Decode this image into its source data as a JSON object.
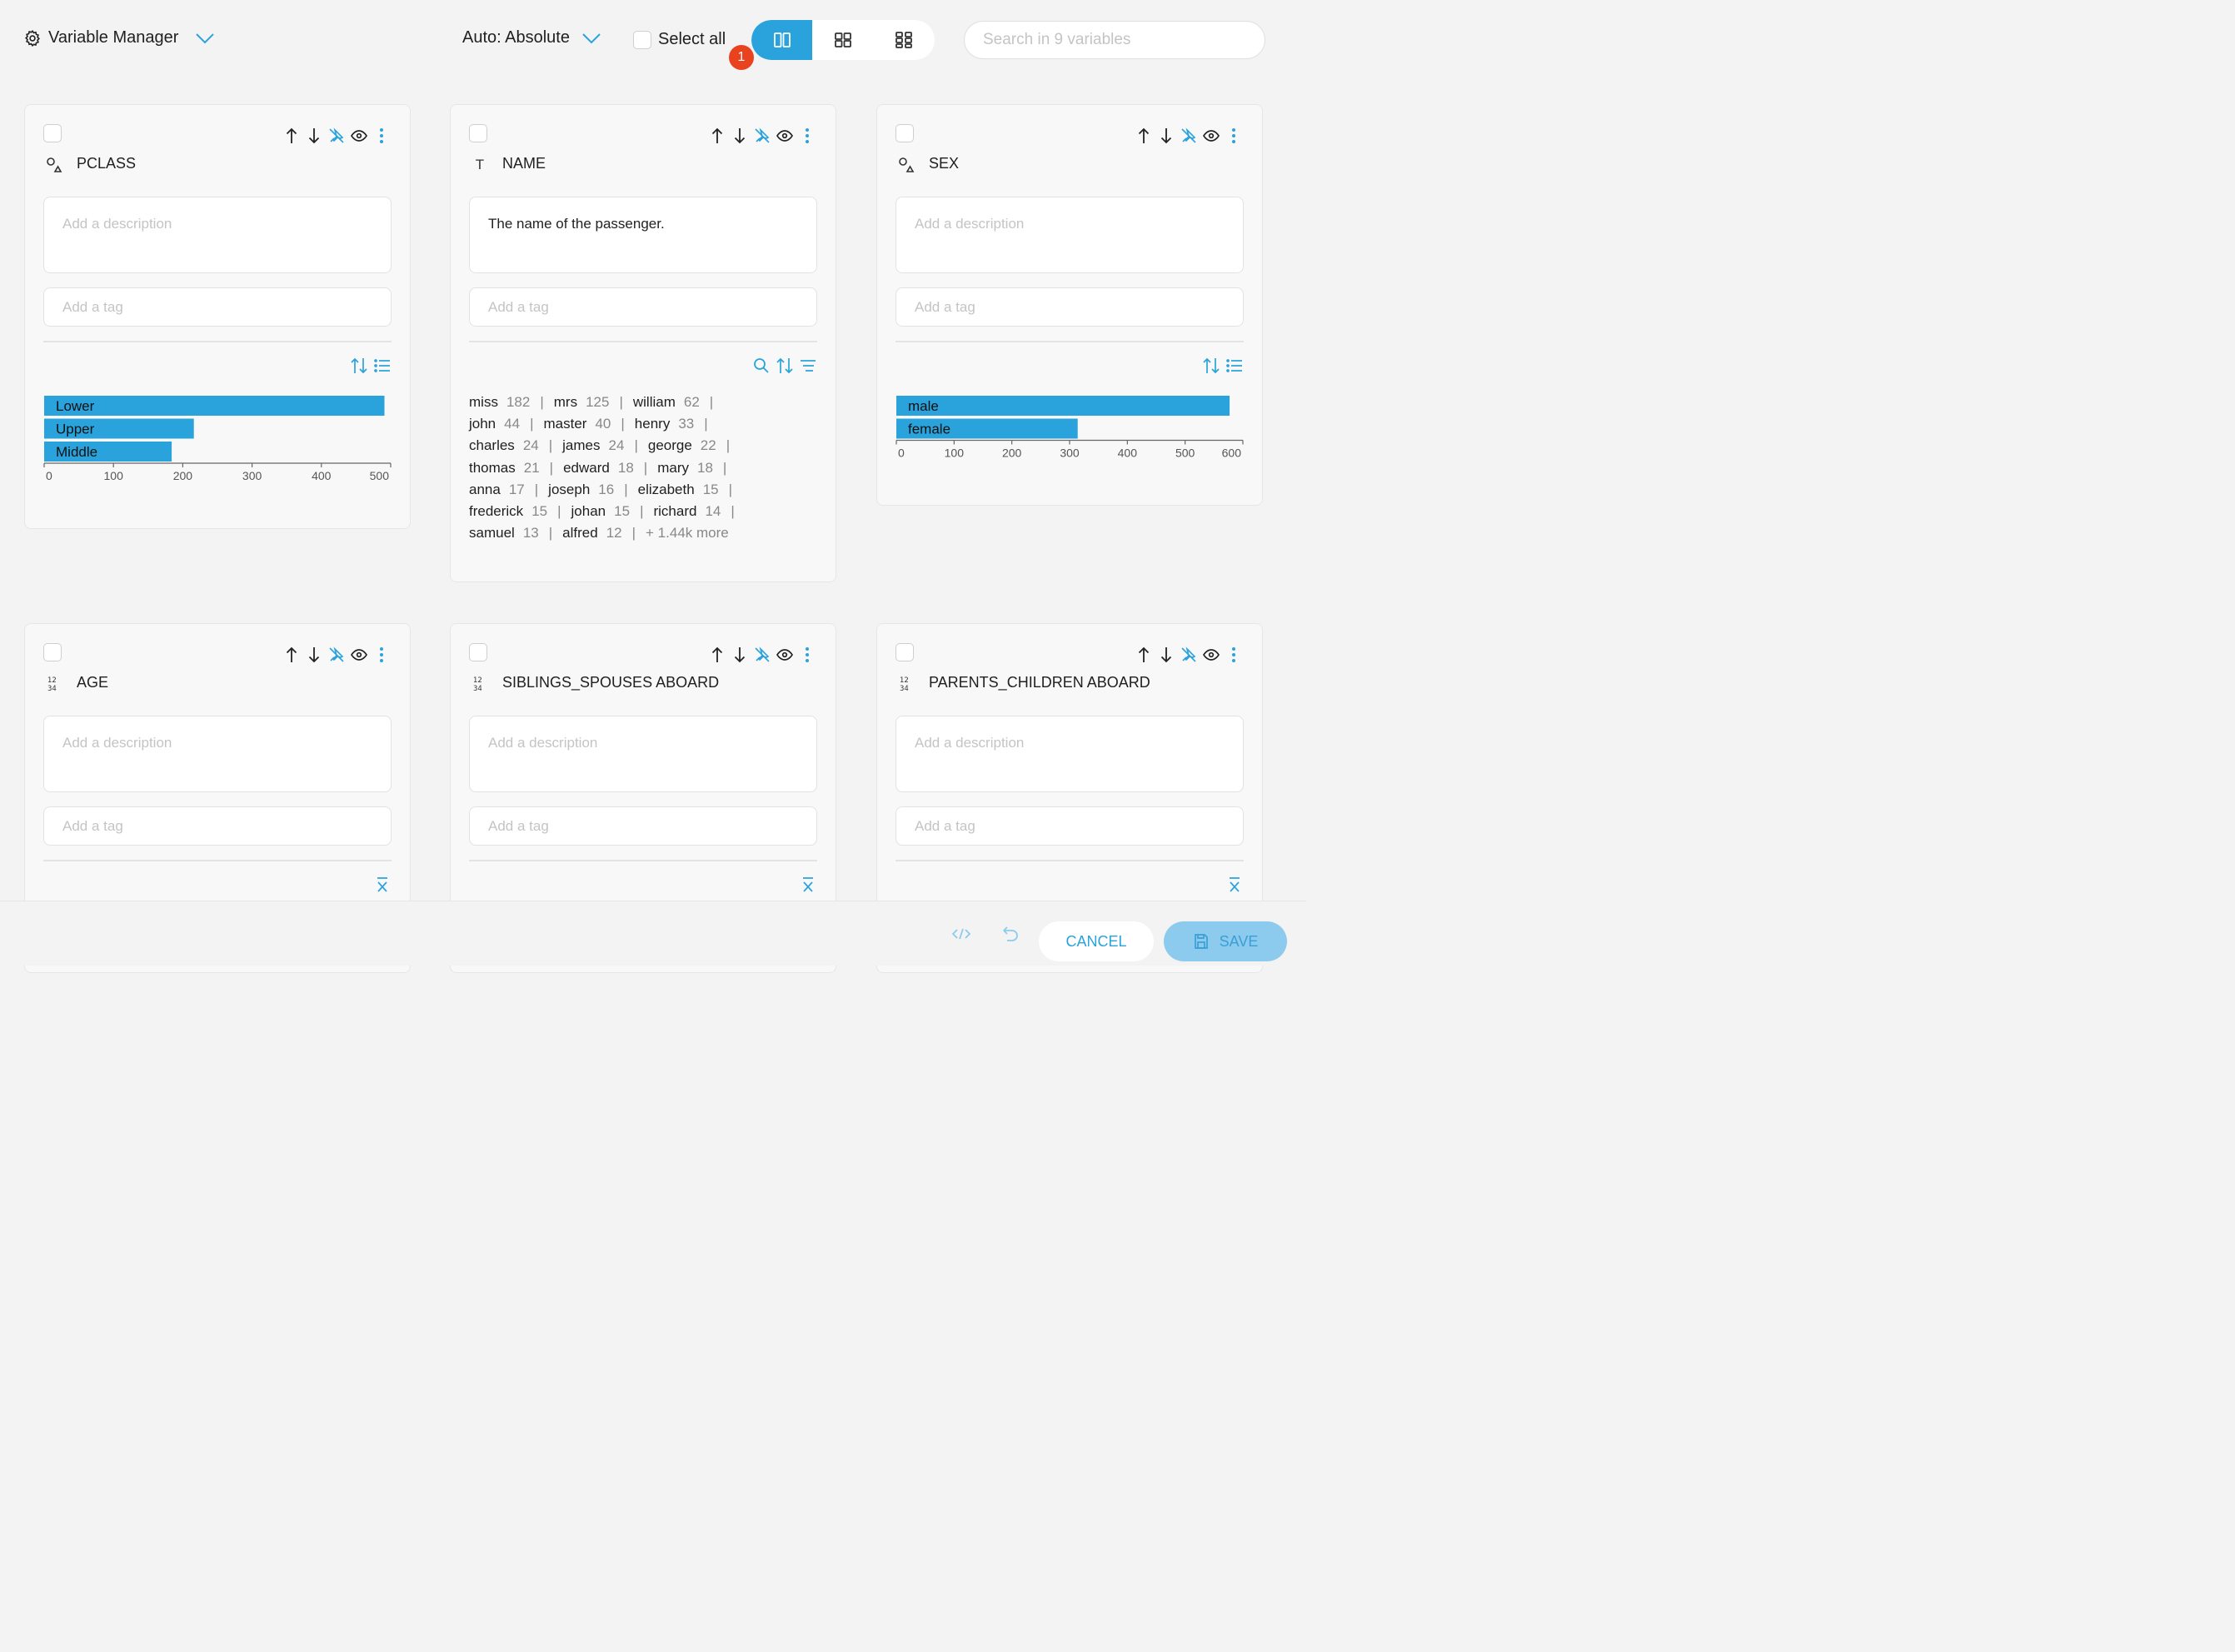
{
  "header": {
    "title": "Variable Manager",
    "mode_label": "Auto: Absolute",
    "select_all_label": "Select all",
    "badge_count": "1",
    "search_placeholder": "Search in 9 variables"
  },
  "colors": {
    "accent": "#2aa3dd",
    "badge": "#e8421f",
    "bar": "#2aa3dd"
  },
  "cards": [
    {
      "name": "PCLASS",
      "type_icon": "categorical-icon",
      "description_value": "",
      "description_placeholder": "Add a description",
      "tag_placeholder": "Add a tag",
      "chart_data": {
        "type": "bar",
        "orientation": "horizontal",
        "categories": [
          "Lower",
          "Upper",
          "Middle"
        ],
        "values": [
          491,
          216,
          184
        ],
        "xlim": [
          0,
          500
        ],
        "xticks": [
          "0",
          "100",
          "200",
          "300",
          "400",
          "500"
        ]
      }
    },
    {
      "name": "NAME",
      "type_icon": "text-icon",
      "description_value": "The name of the passenger.",
      "description_placeholder": "Add a description",
      "tag_placeholder": "Add a tag",
      "words": [
        {
          "w": "miss",
          "c": "182"
        },
        {
          "w": "mrs",
          "c": "125"
        },
        {
          "w": "william",
          "c": "62"
        },
        {
          "w": "john",
          "c": "44"
        },
        {
          "w": "master",
          "c": "40"
        },
        {
          "w": "henry",
          "c": "33"
        },
        {
          "w": "charles",
          "c": "24"
        },
        {
          "w": "james",
          "c": "24"
        },
        {
          "w": "george",
          "c": "22"
        },
        {
          "w": "thomas",
          "c": "21"
        },
        {
          "w": "edward",
          "c": "18"
        },
        {
          "w": "mary",
          "c": "18"
        },
        {
          "w": "anna",
          "c": "17"
        },
        {
          "w": "joseph",
          "c": "16"
        },
        {
          "w": "elizabeth",
          "c": "15"
        },
        {
          "w": "frederick",
          "c": "15"
        },
        {
          "w": "johan",
          "c": "15"
        },
        {
          "w": "richard",
          "c": "14"
        },
        {
          "w": "samuel",
          "c": "13"
        },
        {
          "w": "alfred",
          "c": "12"
        }
      ],
      "more": "+ 1.44k more"
    },
    {
      "name": "SEX",
      "type_icon": "categorical-icon",
      "description_value": "",
      "description_placeholder": "Add a description",
      "tag_placeholder": "Add a tag",
      "chart_data": {
        "type": "bar",
        "orientation": "horizontal",
        "categories": [
          "male",
          "female"
        ],
        "values": [
          577,
          314
        ],
        "xlim": [
          0,
          600
        ],
        "xticks": [
          "0",
          "100",
          "200",
          "300",
          "400",
          "500",
          "600"
        ]
      }
    },
    {
      "name": "AGE",
      "type_icon": "numeric-icon",
      "description_value": "",
      "description_placeholder": "Add a description",
      "tag_placeholder": "Add a tag"
    },
    {
      "name": "SIBLINGS_SPOUSES ABOARD",
      "type_icon": "numeric-icon",
      "description_value": "",
      "description_placeholder": "Add a description",
      "tag_placeholder": "Add a tag"
    },
    {
      "name": "PARENTS_CHILDREN ABOARD",
      "type_icon": "numeric-icon",
      "description_value": "",
      "description_placeholder": "Add a description",
      "tag_placeholder": "Add a tag"
    }
  ],
  "footer": {
    "cancel_label": "CANCEL",
    "save_label": "SAVE"
  }
}
